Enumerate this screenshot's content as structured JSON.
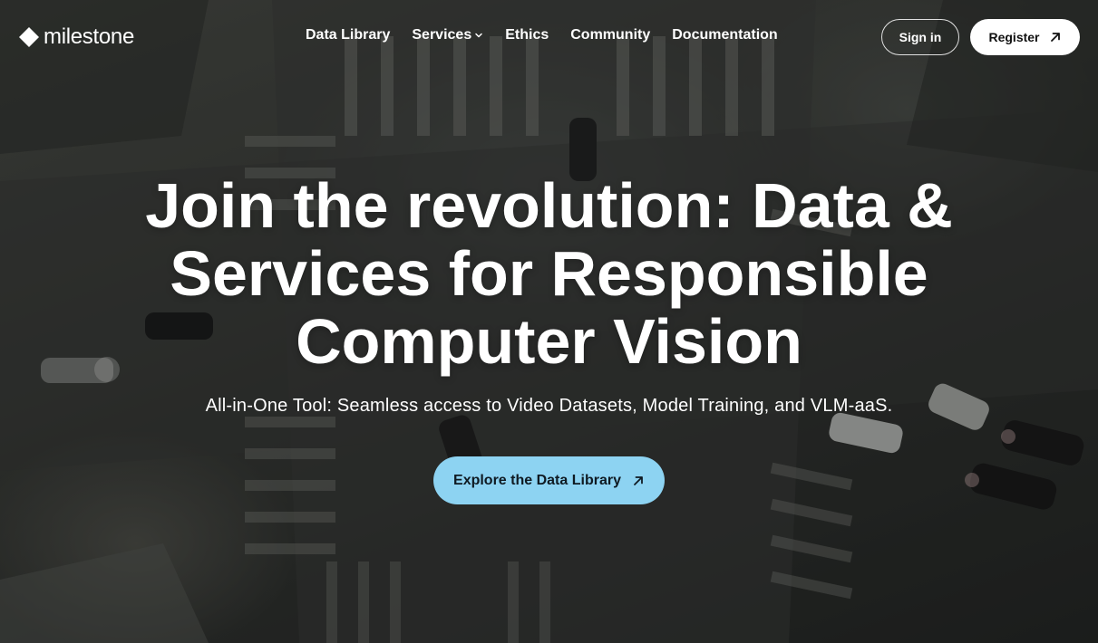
{
  "brand": {
    "name": "milestone"
  },
  "nav": {
    "items": [
      {
        "label": "Data Library"
      },
      {
        "label": "Services",
        "has_dropdown": true
      },
      {
        "label": "Ethics"
      },
      {
        "label": "Community"
      },
      {
        "label": "Documentation"
      }
    ],
    "sign_in_label": "Sign in",
    "register_label": "Register"
  },
  "hero": {
    "headline_line1": "Join the revolution: Data &",
    "headline_line2": "Services for Responsible",
    "headline_line3": "Computer Vision",
    "subtitle": "All-in-One Tool: Seamless access to Video Datasets, Model Training, and VLM-aaS.",
    "cta_label": "Explore the Data Library"
  },
  "icons": {
    "logo": "diamond-logo-icon",
    "dropdown": "chevron-down-icon",
    "external": "arrow-up-right-icon"
  },
  "colors": {
    "cta_background": "#8dd3f2",
    "register_background": "#ffffff",
    "text": "#ffffff"
  }
}
